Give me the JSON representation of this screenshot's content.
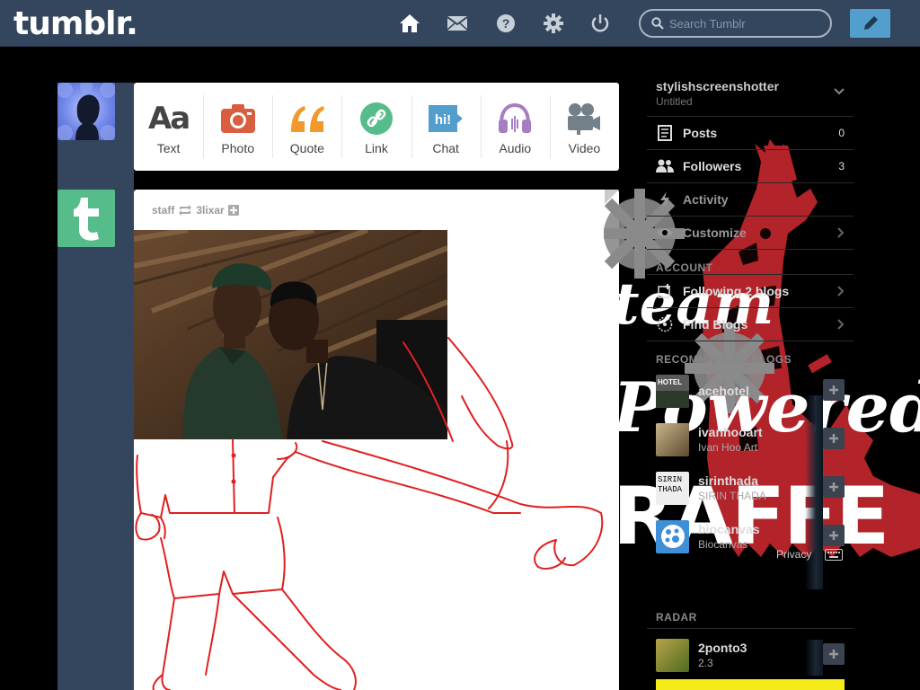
{
  "header": {
    "logo": "tumblr.",
    "search_placeholder": "Search Tumblr",
    "nav": [
      "home-icon",
      "mail-icon",
      "help-icon",
      "gear-icon",
      "power-icon"
    ]
  },
  "post_types": [
    {
      "label": "Text",
      "icon": "text-icon",
      "color": "#444444"
    },
    {
      "label": "Photo",
      "icon": "camera-icon",
      "color": "#d95e40"
    },
    {
      "label": "Quote",
      "icon": "quote-icon",
      "color": "#f2992e"
    },
    {
      "label": "Link",
      "icon": "link-icon",
      "color": "#56bc8a"
    },
    {
      "label": "Chat",
      "icon": "chat-icon",
      "color": "#529ecc"
    },
    {
      "label": "Audio",
      "icon": "headphones-icon",
      "color": "#a77dc2"
    },
    {
      "label": "Video",
      "icon": "video-camera-icon",
      "color": "#748089"
    }
  ],
  "post": {
    "author": "staff",
    "reblogged_from": "3lixar"
  },
  "sidebar": {
    "blog_name": "stylishscreenshotter",
    "blog_subtitle": "Untitled",
    "rows": [
      {
        "label": "Posts",
        "count": "0",
        "icon": "posts-icon"
      },
      {
        "label": "Followers",
        "count": "3",
        "icon": "followers-icon"
      },
      {
        "label": "Activity",
        "count": "",
        "icon": "activity-icon"
      },
      {
        "label": "Customize",
        "count": "",
        "icon": "eye-icon"
      }
    ],
    "account_title": "ACCOUNT",
    "account_rows": [
      {
        "label": "Following 2 blogs",
        "icon": "following-icon"
      },
      {
        "label": "Find Blogs",
        "icon": "compass-icon"
      }
    ],
    "recommended_title": "RECOMMENDED BLOGS",
    "recommended": [
      {
        "name": "acehotel",
        "sub": "",
        "color": "#6b6b6b"
      },
      {
        "name": "ivanhooart",
        "sub": "Ivan Hoo Art",
        "color": "#8a7a55"
      },
      {
        "name": "sirinthada",
        "sub": "SIRIN THADA",
        "color": "#eeeeee"
      },
      {
        "name": "biocanvas",
        "sub": "Biocanvas",
        "color": "#3e8fd6"
      }
    ],
    "footer_links": "Privacy",
    "radar_title": "RADAR",
    "radar": {
      "name": "2ponto3",
      "sub": "2.3",
      "color": "#6e8a2d"
    }
  }
}
